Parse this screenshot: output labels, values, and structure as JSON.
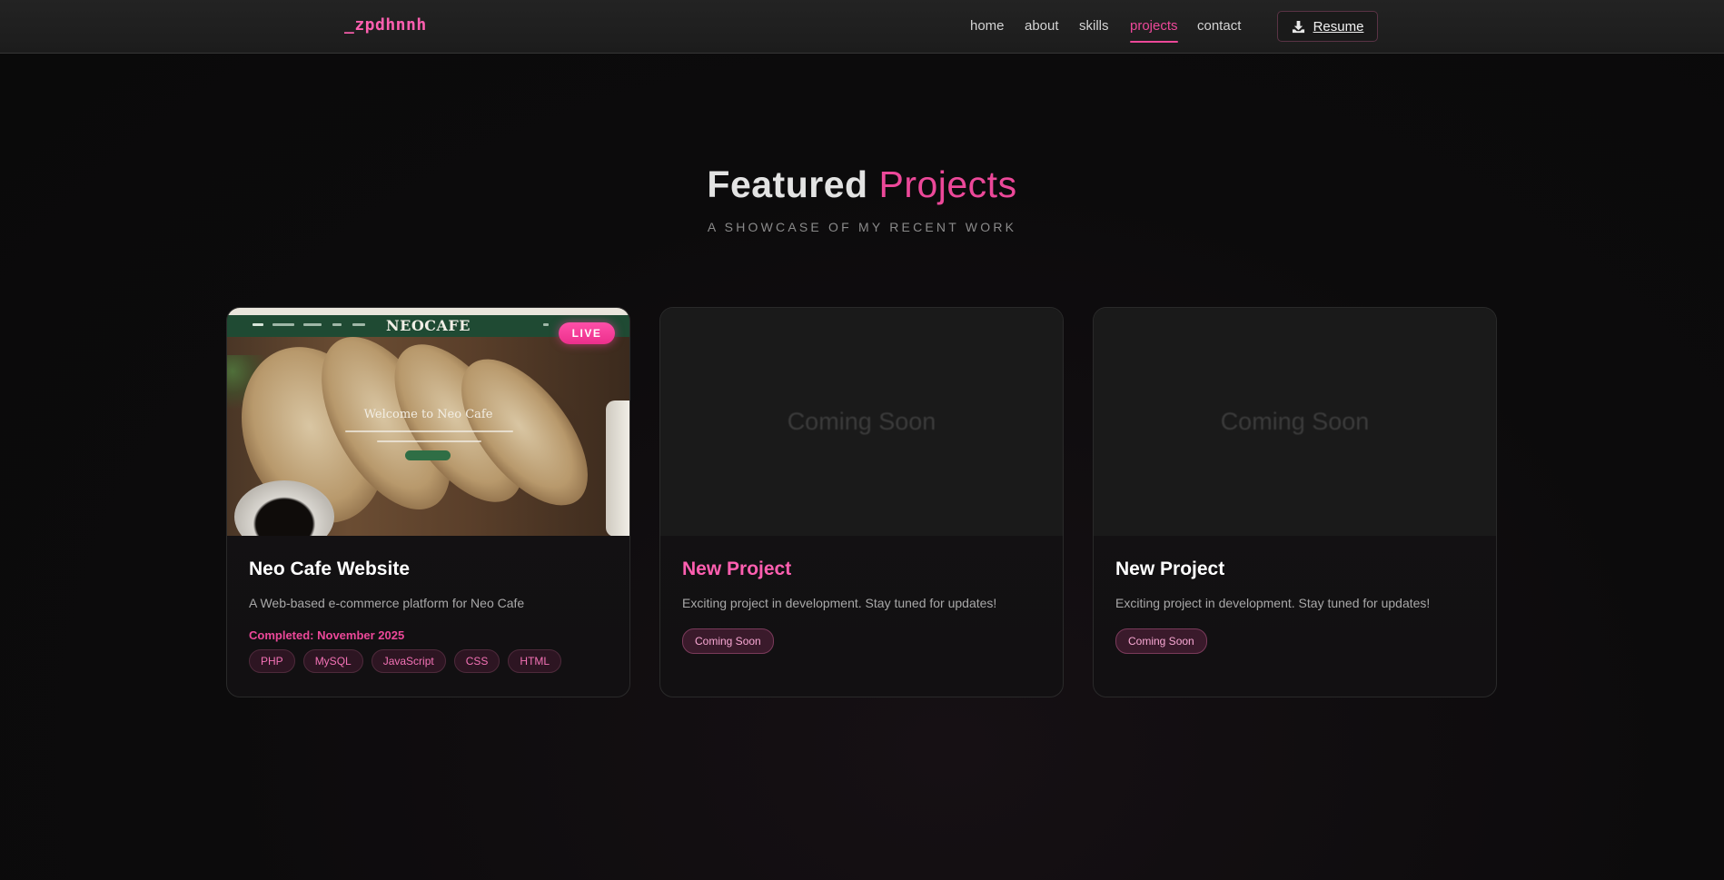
{
  "nav": {
    "logo": "_zpdhnnh",
    "links": [
      "home",
      "about",
      "skills",
      "projects",
      "contact"
    ],
    "active": "projects",
    "resume_label": "Resume"
  },
  "section": {
    "title_part1": "Featured",
    "title_part2": "Projects",
    "subtitle": "A SHOWCASE OF MY RECENT WORK"
  },
  "projects": [
    {
      "title": "Neo Cafe Website",
      "description": "A Web-based e-commerce platform for Neo Cafe",
      "completed": "Completed: November 2025",
      "badge": "LIVE",
      "thumbnail": {
        "brand": "NEOCAFE",
        "welcome": "Welcome to Neo Cafe"
      },
      "tags": [
        "PHP",
        "MySQL",
        "JavaScript",
        "CSS",
        "HTML"
      ]
    },
    {
      "title": "New Project",
      "placeholder": "Coming Soon",
      "description": "Exciting project in development. Stay tuned for updates!",
      "status": "Coming Soon"
    },
    {
      "title": "New Project",
      "placeholder": "Coming Soon",
      "description": "Exciting project in development. Stay tuned for updates!",
      "status": "Coming Soon"
    }
  ],
  "colors": {
    "accent": "#ec4899",
    "background": "#0b0a0b",
    "navbar": "#1f1f1f"
  },
  "icons": {
    "resume": "download-icon"
  }
}
